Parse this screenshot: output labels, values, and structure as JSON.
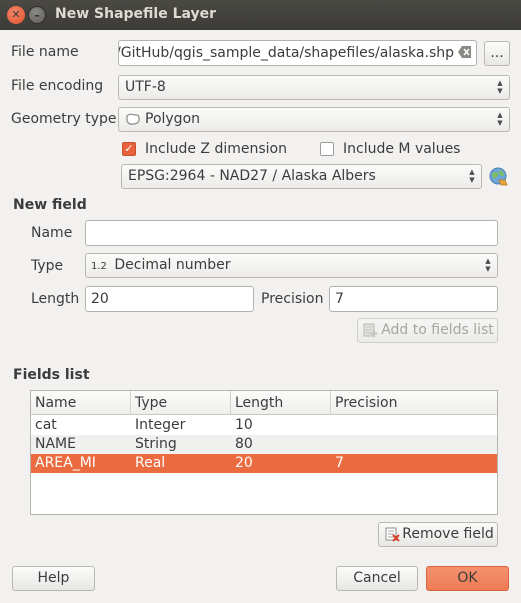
{
  "window": {
    "title": "New Shapefile Layer"
  },
  "file": {
    "label": "File name",
    "value": "//GitHub/qgis_sample_data/shapefiles/alaska.shp",
    "browse_label": "..."
  },
  "encoding": {
    "label": "File encoding",
    "value": "UTF-8"
  },
  "geometry": {
    "label": "Geometry type",
    "value": "Polygon",
    "include_z": {
      "label": "Include Z dimension",
      "checked": true
    },
    "include_m": {
      "label": "Include M values",
      "checked": false
    },
    "crs": "EPSG:2964 - NAD27 / Alaska Albers"
  },
  "new_field": {
    "heading": "New field",
    "name_label": "Name",
    "name_value": "",
    "type_label": "Type",
    "type_value": "Decimal number",
    "type_icon_text": "1.2",
    "length_label": "Length",
    "length_value": "20",
    "precision_label": "Precision",
    "precision_value": "7",
    "add_button": "Add to fields list"
  },
  "fields_list": {
    "heading": "Fields list",
    "columns": [
      "Name",
      "Type",
      "Length",
      "Precision"
    ],
    "rows": [
      {
        "name": "cat",
        "type": "Integer",
        "length": "10",
        "precision": ""
      },
      {
        "name": "NAME",
        "type": "String",
        "length": "80",
        "precision": ""
      },
      {
        "name": "AREA_MI",
        "type": "Real",
        "length": "20",
        "precision": "7"
      }
    ],
    "remove_button": "Remove field"
  },
  "footer": {
    "help": "Help",
    "cancel": "Cancel",
    "ok": "OK"
  },
  "colors": {
    "accent": "#ea6b40",
    "titlebar": "#3c3b37"
  }
}
